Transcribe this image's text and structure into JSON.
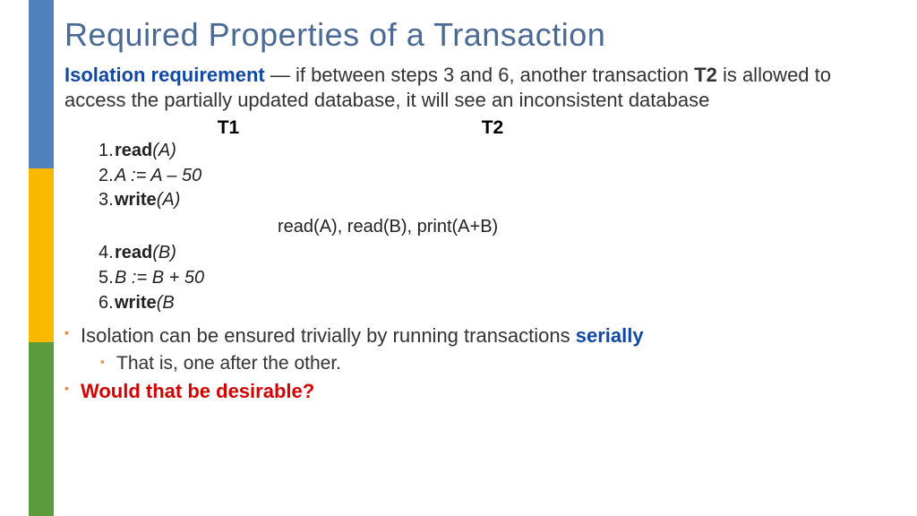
{
  "title": "Required Properties of a Transaction",
  "intro": {
    "lead": "Isolation requirement",
    "sep": " — ",
    "rest1": "if between steps 3 and 6, another transaction ",
    "t2": "T2",
    "rest2": " is allowed to access the partially updated database, it will see an inconsistent database"
  },
  "cols": {
    "h1": "T1",
    "h2": "T2"
  },
  "steps": {
    "s1": {
      "n": "1.",
      "op": "read",
      "arg": "(A)"
    },
    "s2": {
      "n": "2.",
      "text": "A := A – 50"
    },
    "s3": {
      "n": "3.",
      "op": "write",
      "arg": "(A)"
    },
    "t2": "read(A), read(B), print(A+B)",
    "s4": {
      "n": "4.",
      "op": "read",
      "arg": "(B)"
    },
    "s5": {
      "n": "5.",
      "text": "B := B + 50"
    },
    "s6": {
      "n": "6.",
      "op": "write",
      "arg": "(B"
    }
  },
  "bul1": {
    "pre": "Isolation can be ensured trivially by running transactions ",
    "serially": "serially"
  },
  "bul1sub": "That is, one after the other.",
  "bul2": "Would that be desirable?"
}
